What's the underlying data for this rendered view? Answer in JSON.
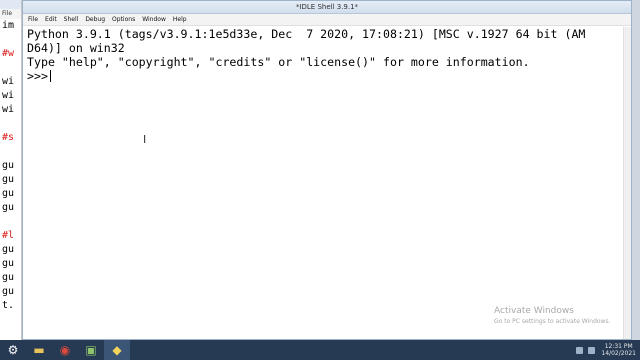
{
  "background_editor": {
    "menu_label": "File",
    "lines": [
      {
        "text": "im",
        "comment": false
      },
      {
        "text": "",
        "comment": false
      },
      {
        "text": "#w",
        "comment": true
      },
      {
        "text": "",
        "comment": false
      },
      {
        "text": "wi",
        "comment": false
      },
      {
        "text": "wi",
        "comment": false
      },
      {
        "text": "wi",
        "comment": false
      },
      {
        "text": "",
        "comment": false
      },
      {
        "text": "#s",
        "comment": true
      },
      {
        "text": "",
        "comment": false
      },
      {
        "text": "gu",
        "comment": false
      },
      {
        "text": "gu",
        "comment": false
      },
      {
        "text": "gu",
        "comment": false
      },
      {
        "text": "gu",
        "comment": false
      },
      {
        "text": "",
        "comment": false
      },
      {
        "text": "#l",
        "comment": true
      },
      {
        "text": "gu",
        "comment": false
      },
      {
        "text": "gu",
        "comment": false
      },
      {
        "text": "gu",
        "comment": false
      },
      {
        "text": "gu",
        "comment": false
      },
      {
        "text": "t.",
        "comment": false
      }
    ]
  },
  "idle": {
    "title": "*IDLE Shell 3.9.1*",
    "menu": [
      "File",
      "Edit",
      "Shell",
      "Debug",
      "Options",
      "Window",
      "Help"
    ],
    "shell_lines": [
      "Python 3.9.1 (tags/v3.9.1:1e5d33e, Dec  7 2020, 17:08:21) [MSC v.1927 64 bit (AM",
      "D64)] on win32",
      "Type \"help\", \"copyright\", \"credits\" or \"license()\" for more information."
    ],
    "prompt": ">>>",
    "cursor_icon": "i-beam-cursor"
  },
  "watermark": {
    "line1": "Activate Windows",
    "line2": "Go to PC settings to activate Windows."
  },
  "taskbar": {
    "apps": [
      {
        "name": "settings-icon",
        "glyph": "⚙",
        "color": "#ffffff"
      },
      {
        "name": "file-explorer-icon",
        "glyph": "▬",
        "color": "#e8c25a"
      },
      {
        "name": "chrome-icon",
        "glyph": "◉",
        "color": "#e04a3a"
      },
      {
        "name": "image-viewer-icon",
        "glyph": "▣",
        "color": "#8fc46a"
      },
      {
        "name": "python-idle-icon",
        "glyph": "◆",
        "color": "#f2d45c"
      }
    ],
    "time": "12:31 PM",
    "date": "14/02/2021"
  }
}
